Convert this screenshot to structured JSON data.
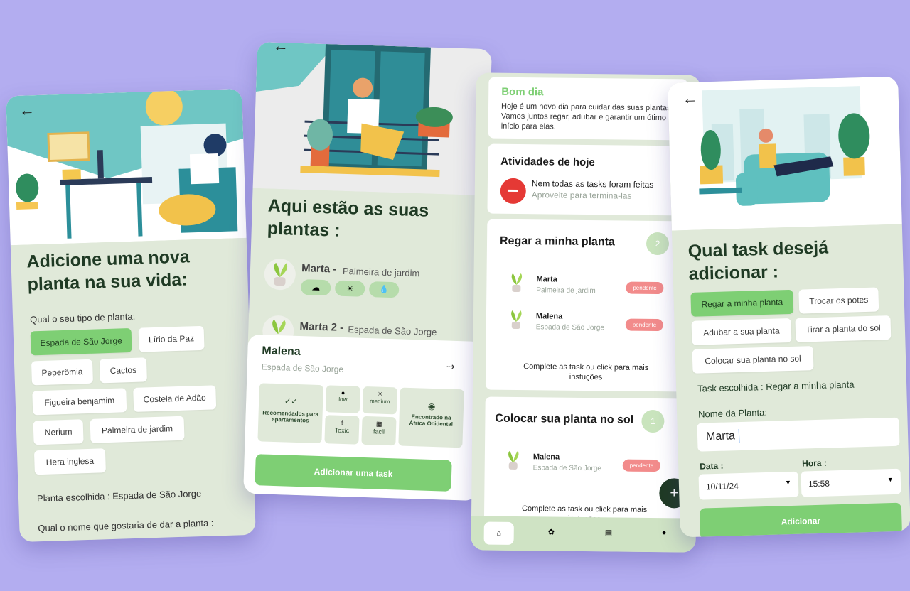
{
  "screen1": {
    "title": "Adicione uma nova planta na sua vida:",
    "type_label": "Qual o seu tipo de planta:",
    "chips": [
      "Espada de São Jorge",
      "Lírio da Paz",
      "Peperômia",
      "Cactos",
      "Figueira benjamim",
      "Costela de Adão",
      "Nerium",
      "Palmeira de jardim",
      "Hera inglesa"
    ],
    "chosen": "Planta escolhida : Espada de São Jorge",
    "name_question": "Qual o nome que gostaria de dar a planta :"
  },
  "screen2": {
    "title": "Aqui estão as suas plantas :",
    "plants": [
      {
        "name": "Marta -",
        "species": "Palmeira de jardim"
      },
      {
        "name": "Marta 2 -",
        "species": "Espada de São Jorge"
      }
    ],
    "sheet": {
      "name": "Malena",
      "species": "Espada de São Jorge",
      "recommended": "Recomendados para apartamentos",
      "water": "low",
      "sun": "medium",
      "toxic": "Toxic",
      "difficulty": "facil",
      "origin": "Encontrado na África Ocidental",
      "add_task": "Adicionar uma task"
    }
  },
  "screen3": {
    "greeting": "Bom dia",
    "greeting_text": "Hoje é um novo dia para cuidar das suas plantas! Vamos juntos regar, adubar e garantir um ótimo início para elas.",
    "today_title": "Atividades de hoje",
    "alert_title": "Nem todas as tasks foram feitas",
    "alert_sub": "Aproveite para termina-las",
    "tasks": [
      {
        "title": "Regar a minha planta",
        "count": "2",
        "items": [
          {
            "name": "Marta",
            "species": "Palmeira de jardim",
            "status": "pendente"
          },
          {
            "name": "Malena",
            "species": "Espada de São Jorge",
            "status": "pendente"
          }
        ],
        "footer": "Complete  as task ou click para mais instuções"
      },
      {
        "title": "Colocar sua planta no sol",
        "count": "1",
        "items": [
          {
            "name": "Malena",
            "species": "Espada de São Jorge",
            "status": "pendente"
          }
        ],
        "footer": "Complete  as task ou click para mais instuções"
      }
    ],
    "fab": "+"
  },
  "screen4": {
    "title": "Qual task desejá adicionar :",
    "chips": [
      "Regar a minha planta",
      "Trocar os potes",
      "Adubar a sua planta",
      "Tirar a planta do sol",
      "Colocar sua planta no sol"
    ],
    "chosen": "Task escolhida : Regar a minha planta",
    "name_label": "Nome da Planta:",
    "name_value": "Marta",
    "date_label": "Data :",
    "date_value": "10/11/24",
    "time_label": "Hora :",
    "time_value": "15:58",
    "submit": "Adicionar"
  },
  "colors": {
    "background": "#b3adf0",
    "accent_green": "#7ecf74",
    "dark_green": "#1f3a24",
    "panel_green": "#e0e9d9",
    "pending": "#f28b8b",
    "alert": "#e53935"
  }
}
